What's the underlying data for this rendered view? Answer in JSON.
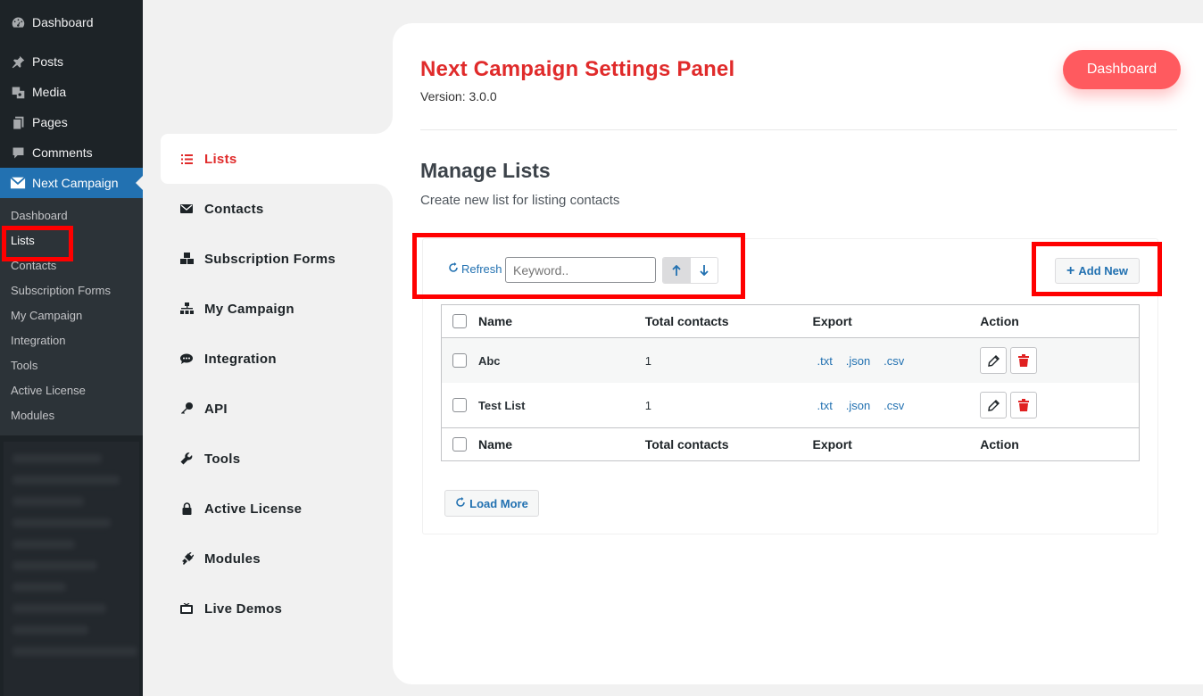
{
  "wp_menu": {
    "items": [
      {
        "label": "Dashboard",
        "icon": "dashboard-icon"
      },
      {
        "label": "Posts",
        "icon": "pin-icon"
      },
      {
        "label": "Media",
        "icon": "media-icon"
      },
      {
        "label": "Pages",
        "icon": "pages-icon"
      },
      {
        "label": "Comments",
        "icon": "comment-icon"
      },
      {
        "label": "Next Campaign",
        "icon": "envelope-icon"
      }
    ],
    "submenu": [
      "Dashboard",
      "Lists",
      "Contacts",
      "Subscription Forms",
      "My Campaign",
      "Integration",
      "Tools",
      "Active License",
      "Modules"
    ],
    "active_submenu": "Lists"
  },
  "plugin_nav": {
    "items": [
      {
        "label": "Lists",
        "icon": "list-icon",
        "active": true
      },
      {
        "label": "Contacts",
        "icon": "envelope-icon"
      },
      {
        "label": "Subscription Forms",
        "icon": "cubes-icon"
      },
      {
        "label": "My Campaign",
        "icon": "sitemap-icon"
      },
      {
        "label": "Integration",
        "icon": "comments-icon"
      },
      {
        "label": "API",
        "icon": "key-icon"
      },
      {
        "label": "Tools",
        "icon": "wrench-icon"
      },
      {
        "label": "Active License",
        "icon": "lock-icon"
      },
      {
        "label": "Modules",
        "icon": "plug-icon"
      },
      {
        "label": "Live Demos",
        "icon": "tv-icon"
      }
    ]
  },
  "header": {
    "title": "Next Campaign Settings Panel",
    "version": "Version: 3.0.0",
    "dashboard_button": "Dashboard"
  },
  "section": {
    "title": "Manage Lists",
    "subtitle": "Create new list for listing contacts"
  },
  "toolbar": {
    "refresh_label": "Refresh",
    "search_placeholder": "Keyword..",
    "add_new_label": "Add New"
  },
  "table": {
    "columns": [
      "Name",
      "Total contacts",
      "Export",
      "Action"
    ],
    "rows": [
      {
        "name": "Abc",
        "total": "1",
        "exports": [
          ".txt",
          ".json",
          ".csv"
        ]
      },
      {
        "name": "Test List",
        "total": "1",
        "exports": [
          ".txt",
          ".json",
          ".csv"
        ]
      }
    ]
  },
  "load_more_label": "Load More",
  "colors": {
    "brand_red": "#e02b2b",
    "dashboard_button": "#ff5a5f",
    "wp_sidebar": "#1d2327",
    "wp_active": "#2271b1",
    "link_blue": "#2271b1",
    "delete_red": "#e02020",
    "highlight": "#ff0000"
  }
}
